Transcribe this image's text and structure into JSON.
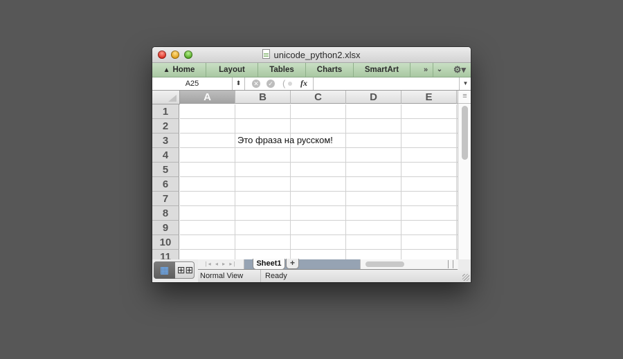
{
  "window": {
    "title": "unicode_python2.xlsx",
    "file_icon": "spreadsheet-file-icon"
  },
  "ribbon": {
    "tabs": [
      {
        "label": "Home",
        "icon": "home-icon"
      },
      {
        "label": "Layout"
      },
      {
        "label": "Tables"
      },
      {
        "label": "Charts"
      },
      {
        "label": "SmartArt"
      }
    ],
    "more_glyph": "»",
    "collapse_glyph": "⌄",
    "gear_glyph": "⚙▾"
  },
  "formula_bar": {
    "name_box": "A25",
    "stepper_glyph": "⬍",
    "cancel_glyph": "✕",
    "enter_glyph": "✓",
    "fx_label": "fx",
    "formula_value": "",
    "dropdown_glyph": "▼"
  },
  "sheet": {
    "columns": [
      "A",
      "B",
      "C",
      "D",
      "E"
    ],
    "selected_column": "A",
    "rows": [
      "1",
      "2",
      "3",
      "4",
      "5",
      "6",
      "7",
      "8",
      "9",
      "10",
      "11"
    ],
    "cells": [
      {
        "ref": "B3",
        "value": "Это фраза на русском!"
      }
    ]
  },
  "bottom": {
    "view_normal_glyph": "▦",
    "view_layout_glyph": "⊞⊞",
    "sheet_nav_glyph": "|◂ ◂ ▸ ▸|",
    "sheet_tabs": [
      "Sheet1"
    ],
    "add_sheet": "+",
    "status_view": "Normal View",
    "status_state": "Ready"
  }
}
